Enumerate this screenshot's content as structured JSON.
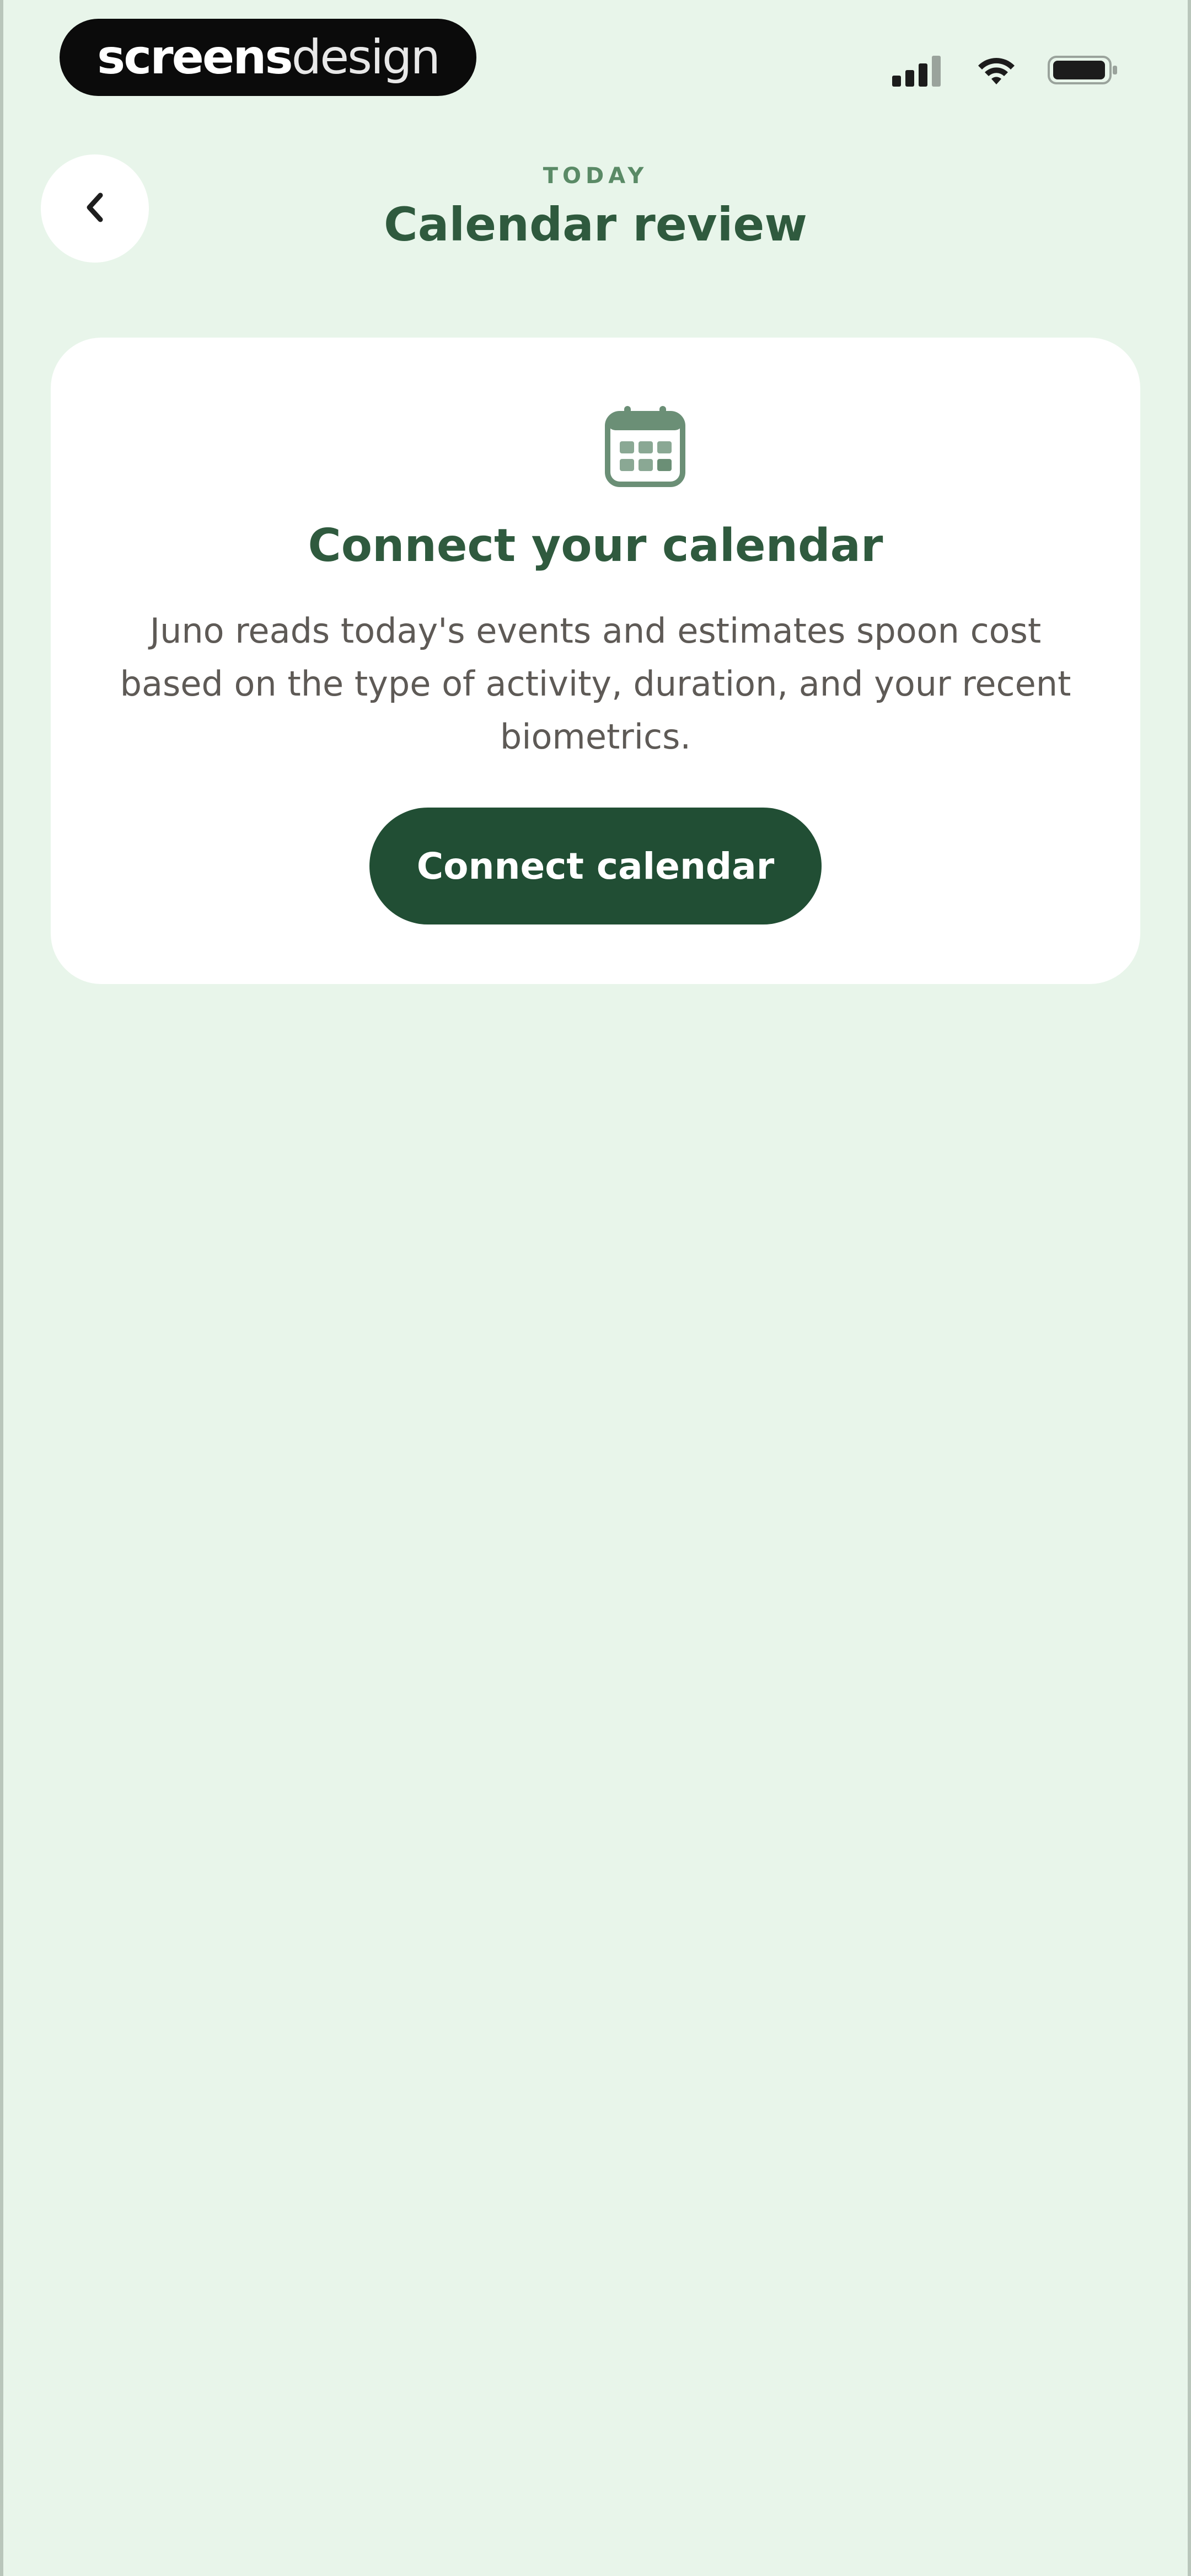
{
  "status_bar": {
    "brand": {
      "bold": "screens",
      "light": "design"
    },
    "icons": [
      "signal-icon",
      "wifi-icon",
      "battery-icon"
    ]
  },
  "header": {
    "back_icon": "chevron-left-icon",
    "overline": "TODAY",
    "title": "Calendar review"
  },
  "card": {
    "icon": "calendar-icon",
    "title": "Connect your calendar",
    "body": "Juno reads today's events and estimates spoon cost based on the type of activity, duration, and your recent biometrics.",
    "button_label": "Connect calendar"
  },
  "colors": {
    "background": "#e8f5ea",
    "card": "#ffffff",
    "primary_dark": "#214e34",
    "title_text": "#2f5a3e",
    "overline_text": "#5a8a66",
    "body_text": "#5e5a56"
  }
}
